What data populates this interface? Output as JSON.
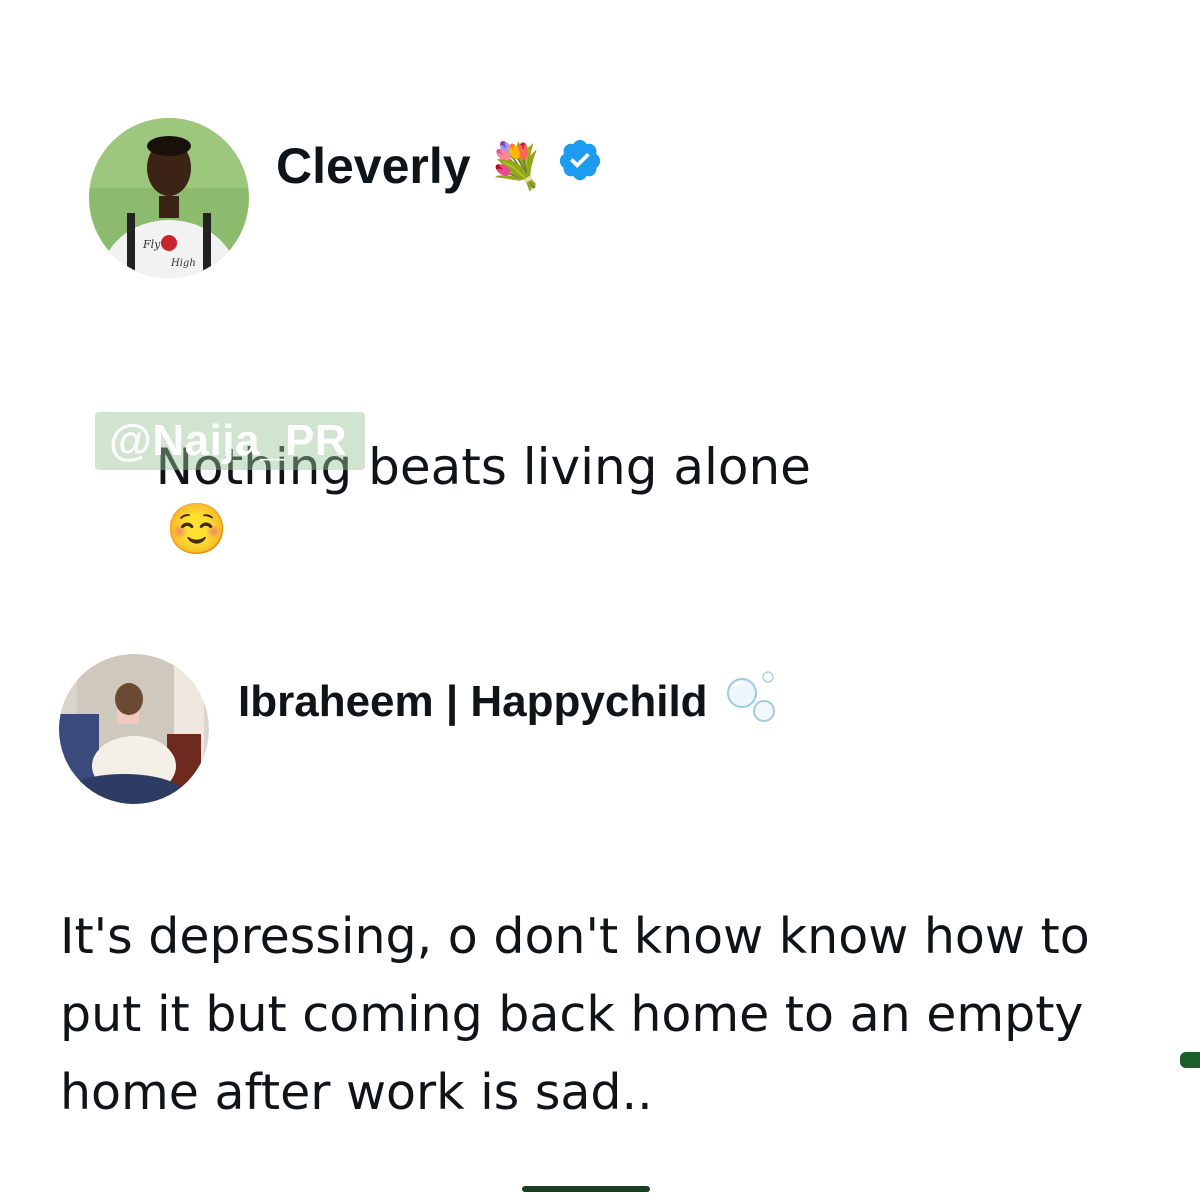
{
  "post1": {
    "author_name": "Cleverly",
    "name_emoji": "💐",
    "verified_icon": "verified-badge-icon",
    "text": "Nothing beats living alone",
    "text_emoji": "☺️",
    "watermark": "@Naija_PR",
    "avatar_icon": "avatar-photo"
  },
  "post2": {
    "author_name": "Ibraheem | Happychild",
    "name_emoji": "🫧",
    "text": "It's depressing, o don't know know how to\nput it but coming back home to an empty\nhome after work is sad..",
    "avatar_icon": "avatar-photo"
  },
  "colors": {
    "verified_blue": "#1d9bf0",
    "text": "#0f1419",
    "watermark_bg": "#96c396",
    "accent_green": "#1b5e2a"
  }
}
